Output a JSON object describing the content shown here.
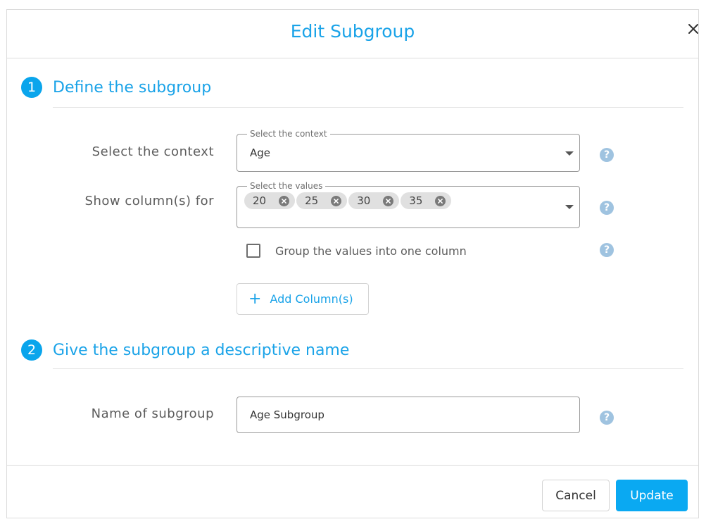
{
  "dialog": {
    "title": "Edit Subgroup",
    "close_icon": "close-icon"
  },
  "step1": {
    "number": "1",
    "title": "Define the subgroup",
    "context": {
      "label": "Select the context",
      "legend": "Select the context",
      "value": "Age"
    },
    "columns": {
      "label": "Show column(s) for",
      "legend": "Select the values",
      "chips": [
        "20",
        "25",
        "30",
        "35"
      ]
    },
    "group_checkbox": {
      "label": "Group the values into one column",
      "checked": false
    },
    "add_button_label": "Add Column(s)"
  },
  "step2": {
    "number": "2",
    "title": "Give the subgroup a descriptive name",
    "name": {
      "label": "Name of subgroup",
      "value": "Age Subgroup"
    }
  },
  "footer": {
    "cancel_label": "Cancel",
    "update_label": "Update"
  },
  "help_icon_glyph": "?",
  "colors": {
    "accent": "#1aa3e8",
    "primary_button": "#0aa9f2",
    "help_icon": "#9fc3e0"
  }
}
